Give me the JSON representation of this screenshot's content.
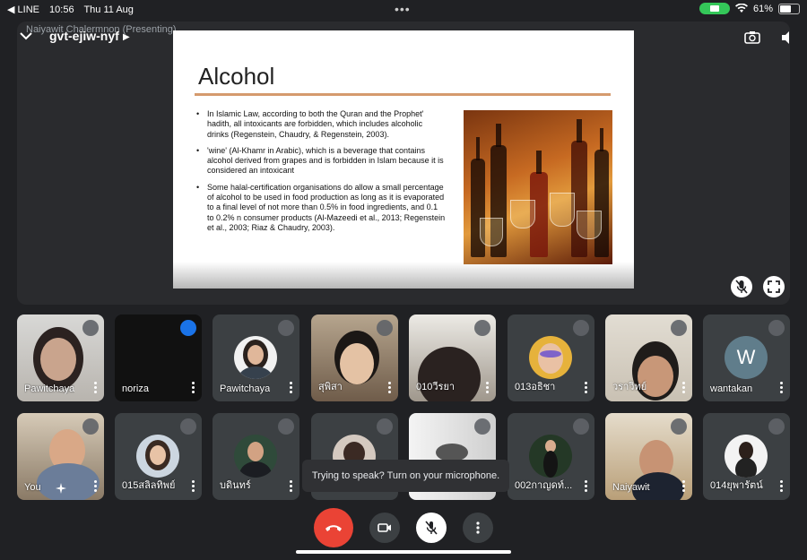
{
  "status_bar": {
    "back_app": "◀ LINE",
    "time": "10:56",
    "date": "Thu 11 Aug",
    "battery": "61%",
    "battery_level": 0.61
  },
  "stage": {
    "presenting_label": "Naiyawit Chalermnon (Presenting)",
    "meeting_code": "gvt-ejiw-nyf",
    "slide": {
      "title": "Alcohol",
      "bullets": [
        "In Islamic Law, according to both the Quran and the Prophet' hadith, all intoxicants are forbidden, which includes alcoholic drinks (Regenstein, Chaudry, & Regenstein, 2003).",
        "'wine' (Al-Khamr in Arabic), which is a beverage that contains alcohol derived from grapes and is forbidden in Islam because it is considered an intoxicant",
        "Some halal-certification organisations do allow a small percentage of alcohol to be used in food production as long as it is evaporated to a final level of not more than 0.5% in food ingredients, and 0.1 to 0.2% n consumer products (Al-Mazeedi et al., 2013; Regenstein et al., 2003; Riaz & Chaudry, 2003)."
      ]
    }
  },
  "participants": [
    {
      "name": "Pawitchaya"
    },
    {
      "name": "noriza"
    },
    {
      "name": "Pawitchaya"
    },
    {
      "name": "สุพิสา"
    },
    {
      "name": "010วีรยา"
    },
    {
      "name": "013อธิชา"
    },
    {
      "name": "วราวิทย์"
    },
    {
      "name": "wantakan",
      "initial": "W"
    },
    {
      "name": "You"
    },
    {
      "name": "015สลิลทิพย์"
    },
    {
      "name": "บดินทร์"
    },
    {
      "name": ""
    },
    {
      "name": ""
    },
    {
      "name": "002กาญดท์..."
    },
    {
      "name": "Naiyawit"
    },
    {
      "name": "014ยุพารัตน์"
    }
  ],
  "toast": "Trying to speak? Turn on your microphone.",
  "colors": {
    "background": "#202124",
    "end_call": "#ea4335",
    "speaking": "#1a73e8"
  }
}
